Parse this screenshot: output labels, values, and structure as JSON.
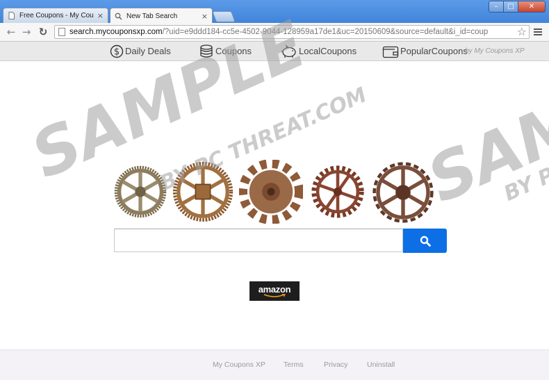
{
  "window": {
    "minimize": "–",
    "maximize": "□",
    "close": "✕"
  },
  "tabs": [
    {
      "label": "Free Coupons - My Coupo",
      "close": "×"
    },
    {
      "label": "New Tab Search",
      "close": "×"
    }
  ],
  "toolbar": {
    "back": "←",
    "forward": "→",
    "reload": "↻",
    "url_host": "search.mycouponsxp.com",
    "url_rest": "/?uid=e9ddd184-cc5e-4502-9044-128959a17de1&uc=20150609&source=default&i_id=coup",
    "star": "☆"
  },
  "coupon_bar": {
    "items": [
      {
        "label": "Daily Deals",
        "icon": "dollar-coin-icon"
      },
      {
        "label": "Coupons",
        "icon": "coin-stack-icon"
      },
      {
        "label": "LocalCoupons",
        "icon": "piggy-bank-icon"
      },
      {
        "label": "PopularCoupons",
        "icon": "wallet-icon"
      }
    ],
    "brand": "by My Coupons XP"
  },
  "search": {
    "placeholder": "",
    "button_icon": "magnifier-icon"
  },
  "amazon": {
    "label": "amazon"
  },
  "footer": {
    "links": [
      "My Coupons XP",
      "Terms",
      "Privacy",
      "Uninstall"
    ]
  },
  "watermark": {
    "big1": "SAMPLE",
    "small1": "BY PC THREAT.COM",
    "big2": "SAMPLE",
    "small2": "BY PC"
  },
  "colors": {
    "accent": "#0d6fe6",
    "titlebar": "#3b7fd8",
    "amazon_bg": "#1e1e1e"
  }
}
